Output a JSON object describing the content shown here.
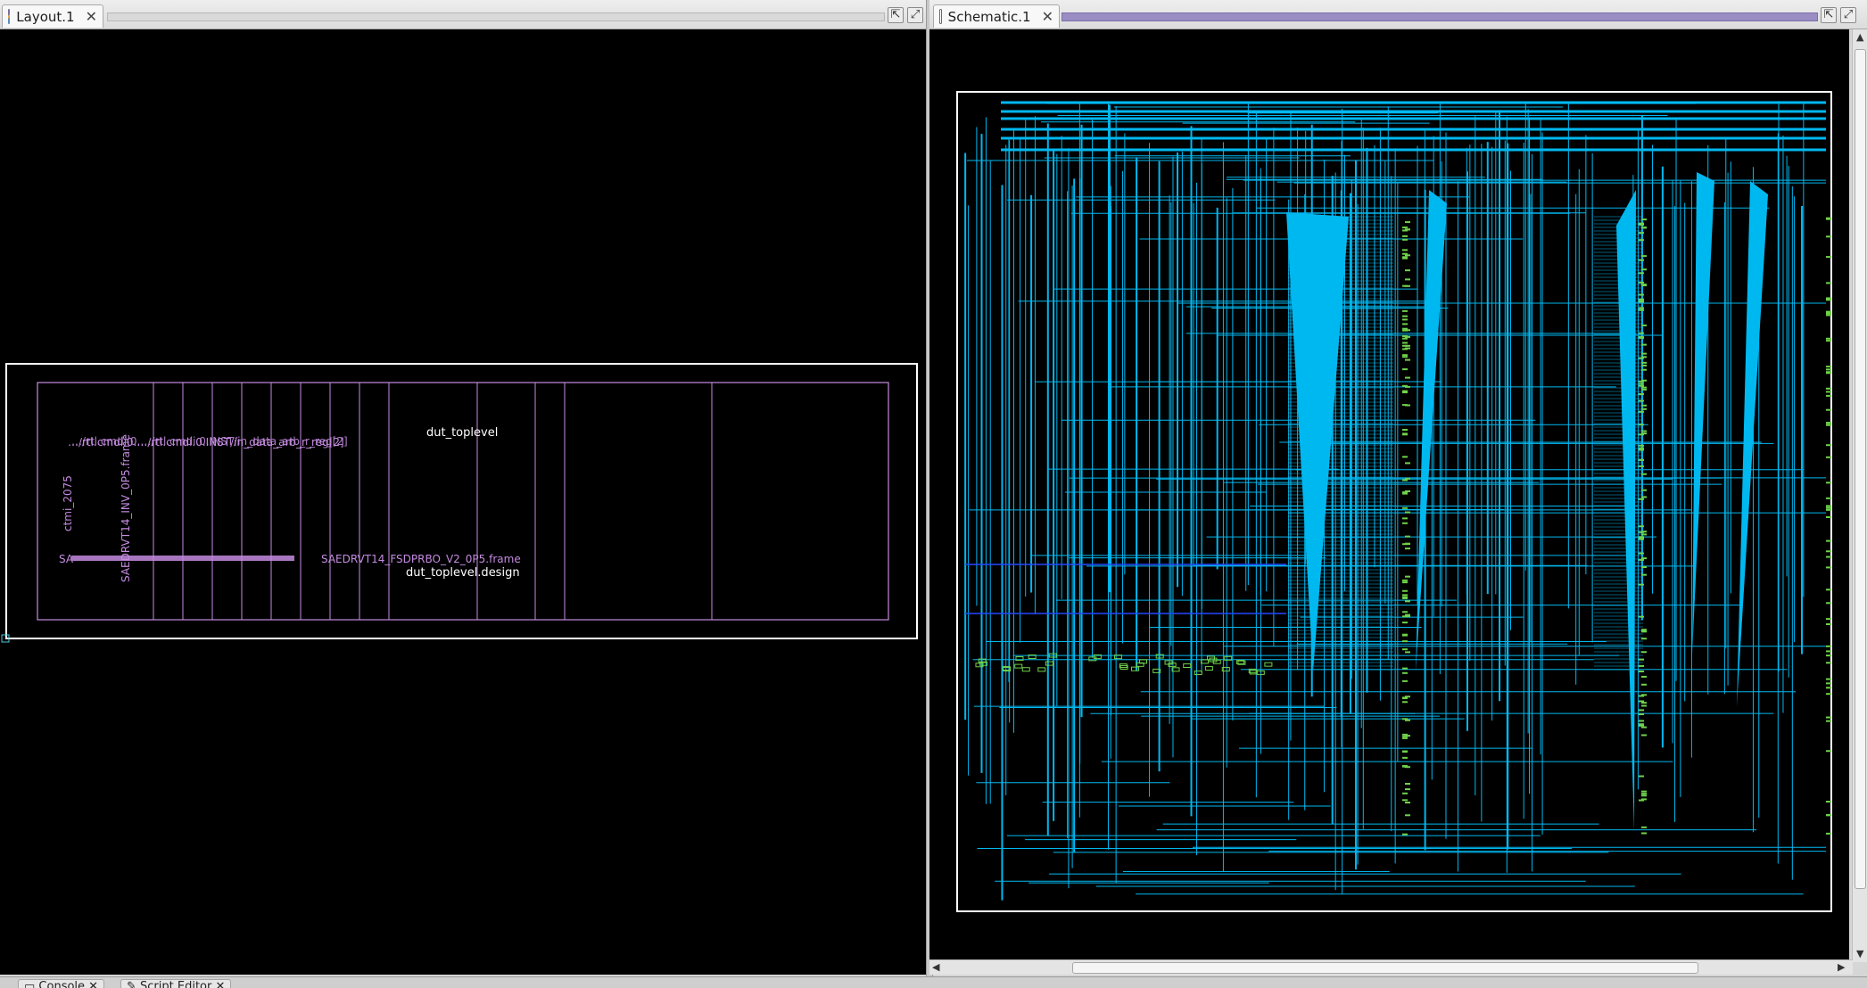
{
  "layout_tab": {
    "title": "Layout.1",
    "close": "✕"
  },
  "schematic_tab": {
    "title": "Schematic.1",
    "close": "✕"
  },
  "layout": {
    "instance_path": "…/rtl.cmdi.0.…/rtl.cmdi.0.INST/in_data_arb_r_reg[2]",
    "cell_frame": "SAEDRVT14_INV_0P5.frame",
    "net_label": "ctmi_2075",
    "top_label": "dut_toplevel",
    "flop_frame": "SAEDRVT14_FSDPRBO_V2_0P5.frame",
    "row_prefix": "SA",
    "design_label": "dut_toplevel.design",
    "colors": {
      "frame": "#c48be0",
      "boundary": "#ffffff",
      "background": "#000000"
    }
  },
  "schematic": {
    "colors": {
      "wire": "#00b8f0",
      "pin": "#6fd24a",
      "bus": "#2448ff",
      "frame": "#ffffff"
    }
  },
  "bottom_tabs": [
    {
      "label": "Console"
    },
    {
      "label": "Script Editor"
    }
  ]
}
